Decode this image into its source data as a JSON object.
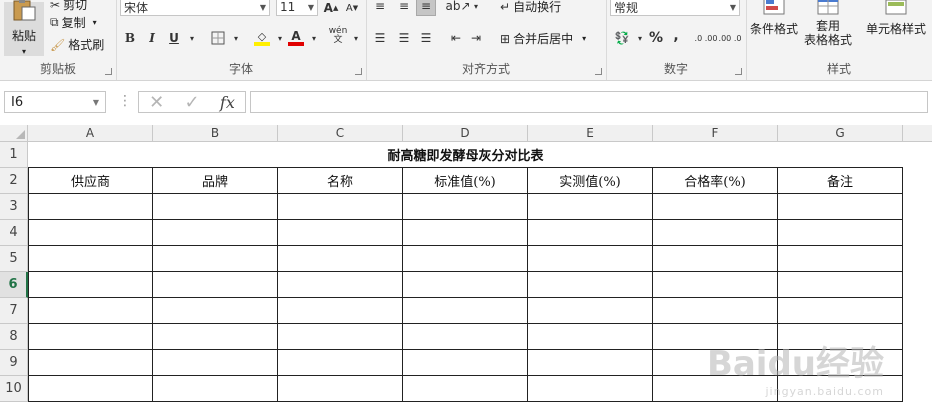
{
  "ribbon": {
    "clipboard": {
      "label": "剪贴板",
      "paste": "粘贴",
      "cut": "剪切",
      "copy": "复制",
      "format_painter": "格式刷"
    },
    "font": {
      "label": "字体",
      "font_name": "宋体",
      "font_size": "11",
      "bold": "B",
      "italic": "I",
      "underline": "U",
      "grow": "A",
      "shrink": "A",
      "wen": "wén",
      "wen_sub": "文"
    },
    "alignment": {
      "label": "对齐方式",
      "wrap": "自动换行",
      "merge": "合并后居中"
    },
    "number": {
      "label": "数字",
      "format": "常规",
      "percent": "%",
      "comma": ",",
      "inc_dec": ".0 .00",
      "dec_dec": ".00 .0"
    },
    "styles": {
      "label": "样式",
      "conditional": "条件格式",
      "table_format_1": "套用",
      "table_format_2": "表格格式",
      "cell_styles": "单元格样式"
    }
  },
  "formula_bar": {
    "name_box": "I6",
    "fx": "fx",
    "formula": ""
  },
  "columns": [
    "A",
    "B",
    "C",
    "D",
    "E",
    "F",
    "G"
  ],
  "rows": [
    "1",
    "2",
    "3",
    "4",
    "5",
    "6",
    "7",
    "8",
    "9",
    "10"
  ],
  "selected_row": "6",
  "sheet": {
    "title": "耐高糖即发酵母灰分对比表",
    "headers": [
      "供应商",
      "品牌",
      "名称",
      "标准值(%)",
      "实测值(%)",
      "合格率(%)",
      "备注"
    ]
  },
  "watermark": {
    "main": "Baidu经验",
    "sub": "jingyan.baidu.com"
  },
  "colors": {
    "accent": "#217346",
    "font_color": "#e00000",
    "highlight": "#ffef00"
  }
}
